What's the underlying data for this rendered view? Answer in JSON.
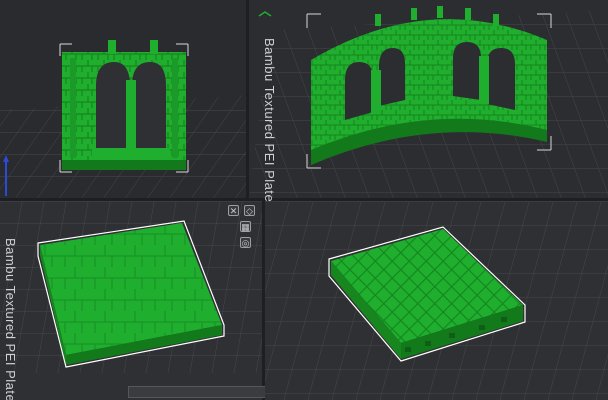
{
  "plate": {
    "label": "Bambu Textured PEI Plate"
  },
  "viewports": [
    {
      "id": "wall-arched-window",
      "model_color": "#1fae2e"
    },
    {
      "id": "curved-arched-wall",
      "model_color": "#1fae2e"
    },
    {
      "id": "stone-floor-tile",
      "model_color": "#1fae2e"
    },
    {
      "id": "lattice-floor-tile",
      "model_color": "#1fae2e"
    }
  ],
  "colors": {
    "bed": "#2f3033",
    "grid": "#44464a",
    "model": "#1fae2e",
    "model_shadow": "#137a1c",
    "selection_outline": "#ffffff",
    "axis_z": "#2a4bd7"
  },
  "icons": [
    "view-cube-icon",
    "axis-indicator-icon",
    "close-icon",
    "orient-icon",
    "arrange-icon",
    "settings-icon"
  ]
}
